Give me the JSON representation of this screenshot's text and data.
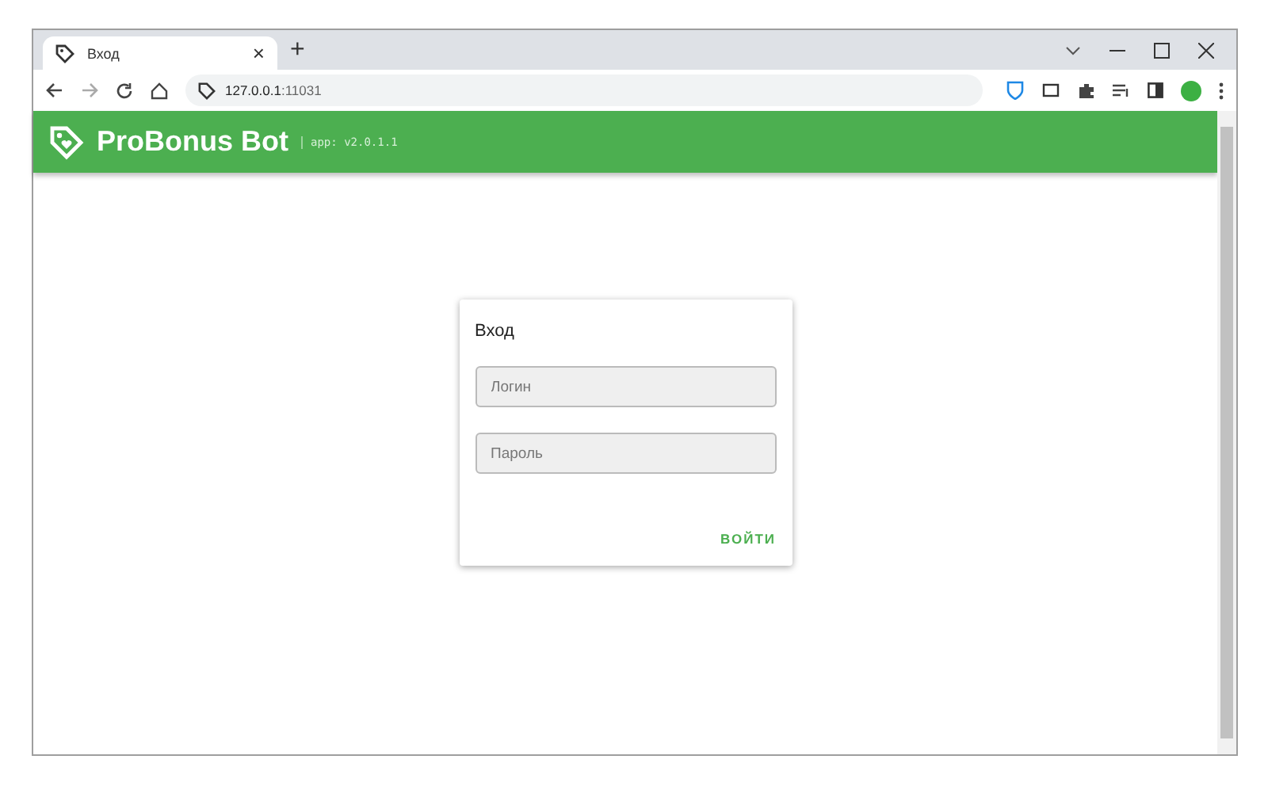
{
  "browser": {
    "tab": {
      "title": "Вход",
      "close": "×"
    },
    "new_tab": "+",
    "address": {
      "host": "127.0.0.1",
      "port": ":11031"
    }
  },
  "app": {
    "title": "ProBonus Bot",
    "version": "app: v2.0.1.1"
  },
  "login": {
    "title": "Вход",
    "fields": [
      {
        "placeholder": "Логин"
      },
      {
        "placeholder": "Пароль"
      }
    ],
    "submit": "ВОЙТИ"
  }
}
